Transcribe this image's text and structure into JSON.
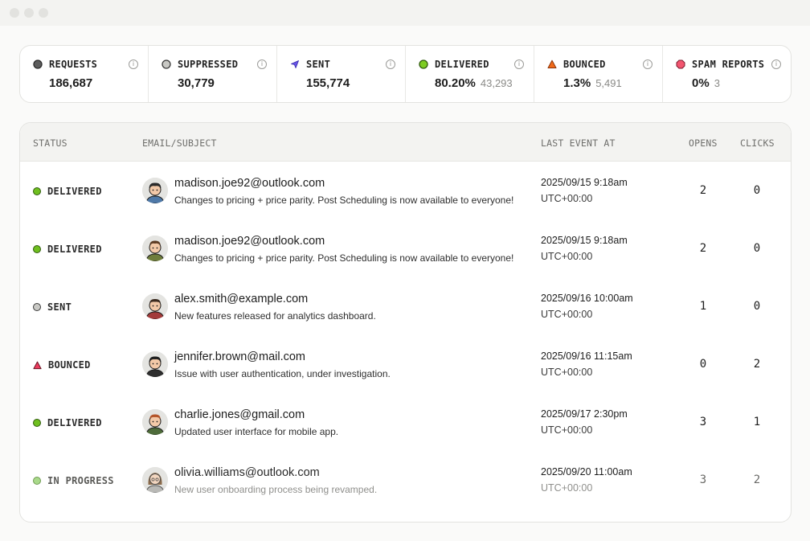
{
  "colors": {
    "delivered": "#6fbf1f",
    "sent": "#c9c9c5",
    "bounced": "#ec3b5e",
    "in_progress": "#a9d98a",
    "requests": "#5d5d5d",
    "suppressed": "#c8c8c4",
    "sent_icon": "#6a55e8",
    "bounced_icon": "#f06a1a",
    "spam": "#f2556f"
  },
  "stats": [
    {
      "label": "REQUESTS",
      "value": "186,687",
      "sub": "",
      "icon": "filled-circle-icon"
    },
    {
      "label": "SUPPRESSED",
      "value": "30,779",
      "sub": "",
      "icon": "diamond-icon"
    },
    {
      "label": "SENT",
      "value": "155,774",
      "sub": "",
      "icon": "send-icon"
    },
    {
      "label": "DELIVERED",
      "value": "80.20%",
      "sub": "43,293",
      "icon": "green-circle-icon"
    },
    {
      "label": "BOUNCED",
      "value": "1.3%",
      "sub": "5,491",
      "icon": "warning-triangle-icon"
    },
    {
      "label": "SPAM REPORTS",
      "value": "0%",
      "sub": "3",
      "icon": "octagon-icon"
    }
  ],
  "table": {
    "headers": {
      "status": "STATUS",
      "email_subject": "EMAIL/SUBJECT",
      "last_event": "LAST EVENT AT",
      "opens": "OPENS",
      "clicks": "CLICKS"
    },
    "rows": [
      {
        "status": "DELIVERED",
        "email": "madison.joe92@outlook.com",
        "subject": "Changes to pricing + price parity. Post Scheduling is now available to everyone!",
        "date": "2025/09/15 9:18am",
        "tz": "UTC+00:00",
        "opens": "2",
        "clicks": "0"
      },
      {
        "status": "DELIVERED",
        "email": "madison.joe92@outlook.com",
        "subject": "Changes to pricing + price parity. Post Scheduling is now available to everyone!",
        "date": "2025/09/15 9:18am",
        "tz": "UTC+00:00",
        "opens": "2",
        "clicks": "0"
      },
      {
        "status": "SENT",
        "email": "alex.smith@example.com",
        "subject": "New features released for analytics dashboard.",
        "date": "2025/09/16 10:00am",
        "tz": "UTC+00:00",
        "opens": "1",
        "clicks": "0"
      },
      {
        "status": "BOUNCED",
        "email": "jennifer.brown@mail.com",
        "subject": "Issue with user authentication, under investigation.",
        "date": "2025/09/16 11:15am",
        "tz": "UTC+00:00",
        "opens": "0",
        "clicks": "2"
      },
      {
        "status": "DELIVERED",
        "email": "charlie.jones@gmail.com",
        "subject": "Updated user interface for mobile app.",
        "date": "2025/09/17 2:30pm",
        "tz": "UTC+00:00",
        "opens": "3",
        "clicks": "1"
      },
      {
        "status": "IN PROGRESS",
        "email": "olivia.williams@outlook.com",
        "subject": "New user onboarding process being revamped.",
        "date": "2025/09/20 11:00am",
        "tz": "UTC+00:00",
        "opens": "3",
        "clicks": "2"
      }
    ]
  }
}
